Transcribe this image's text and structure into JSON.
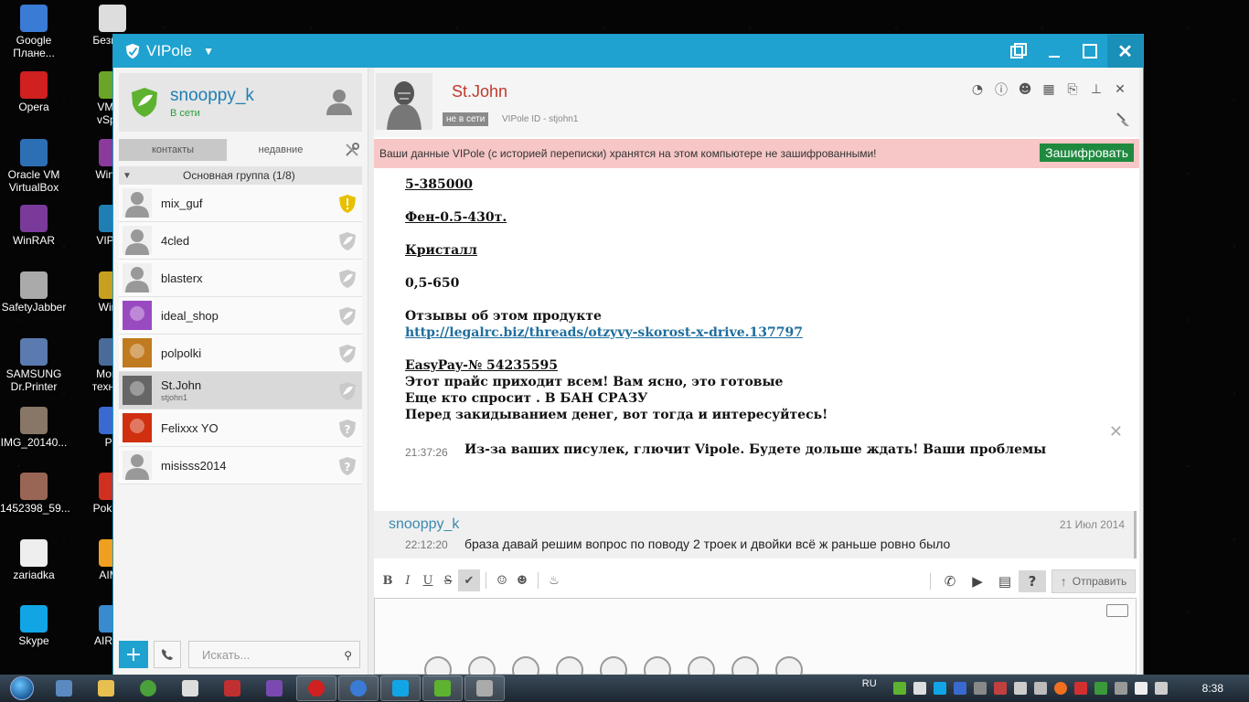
{
  "desktop": {
    "icons": [
      {
        "label": "Google\nПлане...",
        "color": "#3a7bd5"
      },
      {
        "label": "Opera",
        "color": "#d0201f"
      },
      {
        "label": "Oracle VM\nVirtualBox",
        "color": "#2d6fb5"
      },
      {
        "label": "WinRAR",
        "color": "#7a3a9a"
      },
      {
        "label": "SafetyJabber",
        "color": "#aaaaaa"
      },
      {
        "label": "SAMSUNG\nDr.Printer",
        "color": "#5a7ab0"
      },
      {
        "label": "IMG_20140...",
        "color": "#887766"
      },
      {
        "label": "1452398_59...",
        "color": "#996655"
      },
      {
        "label": "zariadka",
        "color": "#eeeeee"
      },
      {
        "label": "Skype",
        "color": "#11a5e6"
      }
    ],
    "icons2": [
      {
        "label": "Безымя",
        "color": "#dddddd"
      },
      {
        "label": "VMwa\nvSphe",
        "color": "#6aa52a"
      },
      {
        "label": "WinRA",
        "color": "#8a3a9a"
      },
      {
        "label": "VIPole",
        "color": "#1f7fb4"
      },
      {
        "label": "WinZi",
        "color": "#c8a020"
      },
      {
        "label": "Монит\nтехноло",
        "color": "#4a6a9a"
      },
      {
        "label": "Psi",
        "color": "#3a6ad0"
      },
      {
        "label": "PokerSt",
        "color": "#d03020"
      },
      {
        "label": "AIMP",
        "color": "#f0a020"
      },
      {
        "label": "AIRead",
        "color": "#3a8ad0"
      }
    ]
  },
  "window": {
    "title": "VIPole"
  },
  "profile": {
    "name": "snooppy_k",
    "status": "В сети"
  },
  "tabs": {
    "contacts": "контакты",
    "recent": "недавние"
  },
  "group": {
    "label": "Основная группа (1/8)"
  },
  "contacts": [
    {
      "name": "mix_guf",
      "sub": "",
      "status": "warning"
    },
    {
      "name": "4cled",
      "sub": "",
      "status": "shield"
    },
    {
      "name": "blasterx",
      "sub": "",
      "status": "shield"
    },
    {
      "name": "ideal_shop",
      "sub": "",
      "status": "shield"
    },
    {
      "name": "polpolki",
      "sub": "",
      "status": "shield"
    },
    {
      "name": "St.John",
      "sub": "stjohn1",
      "status": "shield"
    },
    {
      "name": "Felixxx YO",
      "sub": "",
      "status": "question"
    },
    {
      "name": "misisss2014",
      "sub": "",
      "status": "question"
    }
  ],
  "search": {
    "placeholder": "Искать..."
  },
  "chat": {
    "contact_name": "St.John",
    "offline_badge": "не в сети",
    "vipole_id": "VIPole ID - stjohn1",
    "warning_text": "Ваши данные VIPole (с историей переписки) хранятся на этом компьютере не зашифрованными!",
    "encrypt_button": "Зашифровать",
    "lines": {
      "l1": "5-385000",
      "l2": "Фен-0.5-430т.",
      "l3": "Кристалл",
      "l4": "0,5-650",
      "l5": "Отзывы об этом продукте",
      "l6": "http://legalrc.biz/threads/otzyvy-skorost-x-drive.137797",
      "l7a": "EasyPay-",
      "l7b": "№ 54235595",
      "l8": "Этот прайс приходит всем! Вам ясно, это готовые",
      "l9": "Еще кто спросит . В БАН СРАЗУ",
      "l10": "Перед закидыванием денег, вот тогда и интересуйтесь!"
    },
    "msg1_time": "21:37:26",
    "msg1_text": "Из-за ваших писулек, глючит Vipole. Будете дольше ждать! Ваши проблемы",
    "msg2_author": "snooppy_k",
    "msg2_date": "21 Июл 2014",
    "msg2_time": "22:12:20",
    "msg2_text": "браза давай решим вопрос по поводу 2 троек и двойки всё ж раньше ровно было"
  },
  "toolbar": {
    "bold": "B",
    "italic": "I",
    "underline": "U",
    "strike": "S",
    "help": "?",
    "send": "Отправить"
  },
  "taskbar": {
    "lang": "RU",
    "clock": "8:38"
  }
}
